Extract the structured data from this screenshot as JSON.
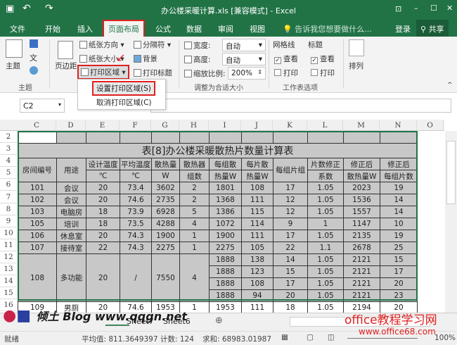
{
  "window": {
    "title": "办公楼采暖计算.xls  [兼容模式] - Excel"
  },
  "qat": {
    "save": "save-icon",
    "undo": "↶",
    "redo": "↷"
  },
  "tabs": [
    {
      "label": "文件"
    },
    {
      "label": "开始"
    },
    {
      "label": "插入"
    },
    {
      "label": "页面布局",
      "active": true
    },
    {
      "label": "公式"
    },
    {
      "label": "数据"
    },
    {
      "label": "审阅"
    },
    {
      "label": "视图"
    }
  ],
  "tellme": "告诉我您想要做什么...",
  "login": "登录",
  "share": "共享",
  "ribbon": {
    "themes": {
      "label": "主题",
      "group": "主题"
    },
    "margins": "页边距",
    "orientation": "纸张方向",
    "size": "纸张大小",
    "print_area": "打印区域",
    "breaks": "分隔符",
    "background": "背景",
    "print_titles": "打印标题",
    "width_label": "宽度:",
    "width_value": "自动",
    "height_label": "高度:",
    "height_value": "自动",
    "scale_label": "缩放比例:",
    "scale_value": "200%",
    "scale_group": "调整为合适大小",
    "gridlines": "网格线",
    "headings": "标题",
    "view": "查看",
    "print": "打印",
    "sheet_options_group": "工作表选项",
    "arrange": "排列"
  },
  "print_area_menu": {
    "set": "设置打印区域(S)",
    "clear": "取消打印区域(C)"
  },
  "formula_bar": {
    "name_box": "C2",
    "formula": ""
  },
  "columns": [
    "C",
    "D",
    "E",
    "F",
    "G",
    "H",
    "I",
    "J",
    "K",
    "L",
    "M",
    "N",
    "O"
  ],
  "row_numbers": [
    "2",
    "3",
    "4",
    "5",
    "6",
    "7",
    "8",
    "9",
    "10",
    "11",
    "12",
    "13",
    "14",
    "15",
    "16"
  ],
  "table": {
    "title": "表[8]办公楼采暖散热片数量计算表",
    "headers_top": [
      "房间编号",
      "用途",
      "设计温度",
      "平均温度",
      "散热量",
      "散热器",
      "每组散",
      "每片散",
      "每组片组",
      "片数修正",
      "修正后",
      "修正后"
    ],
    "headers_bottom": [
      "℃",
      "℃",
      "W",
      "组数",
      "热量W",
      "热量W",
      "系数",
      "散热量W",
      "每组片数"
    ],
    "rows": [
      [
        "101",
        "会议",
        "20",
        "73.4",
        "3602",
        "2",
        "1801",
        "108",
        "17",
        "1.05",
        "2023",
        "19"
      ],
      [
        "102",
        "会议",
        "20",
        "74.6",
        "2735",
        "2",
        "1368",
        "111",
        "12",
        "1.05",
        "1536",
        "14"
      ],
      [
        "103",
        "电脑房",
        "18",
        "73.9",
        "6928",
        "5",
        "1386",
        "115",
        "12",
        "1.05",
        "1557",
        "14"
      ],
      [
        "105",
        "培训",
        "18",
        "73.5",
        "4288",
        "4",
        "1072",
        "114",
        "9",
        "1",
        "1147",
        "10"
      ],
      [
        "106",
        "休息室",
        "20",
        "74.3",
        "1900",
        "1",
        "1900",
        "111",
        "17",
        "1.05",
        "2135",
        "19"
      ],
      [
        "107",
        "接待室",
        "22",
        "74.3",
        "2275",
        "1",
        "2275",
        "105",
        "22",
        "1.1",
        "2678",
        "25"
      ]
    ],
    "merged_row": {
      "left": [
        "108",
        "多功能",
        "20",
        "/",
        "7550",
        "4"
      ],
      "sub": [
        [
          "1888",
          "138",
          "14",
          "1.05",
          "2121",
          "15"
        ],
        [
          "1888",
          "123",
          "15",
          "1.05",
          "2121",
          "17"
        ],
        [
          "1888",
          "108",
          "17",
          "1.05",
          "2121",
          "20"
        ],
        [
          "1888",
          "94",
          "20",
          "1.05",
          "2121",
          "23"
        ]
      ]
    },
    "last_row": [
      "109",
      "男厕",
      "20",
      "74.6",
      "1953",
      "1",
      "1953",
      "111",
      "18",
      "1.05",
      "2194",
      "20"
    ]
  },
  "sheets": [
    {
      "label": "Sheet7"
    },
    {
      "label": "Sheet6"
    }
  ],
  "status": {
    "ready": "就绪",
    "average": "平均值: 811.3649397",
    "count": "计数: 124",
    "sum": "求和: 68983.01987",
    "zoom": "100%"
  },
  "watermarks": {
    "left": "倾土 Blog www.qqgn.net",
    "right1": "office教程学习网",
    "right2": "www.office68.com"
  },
  "colors": {
    "excel_green": "#217346",
    "highlight_red": "#e02020",
    "cell_gray": "#c8c8c8"
  }
}
